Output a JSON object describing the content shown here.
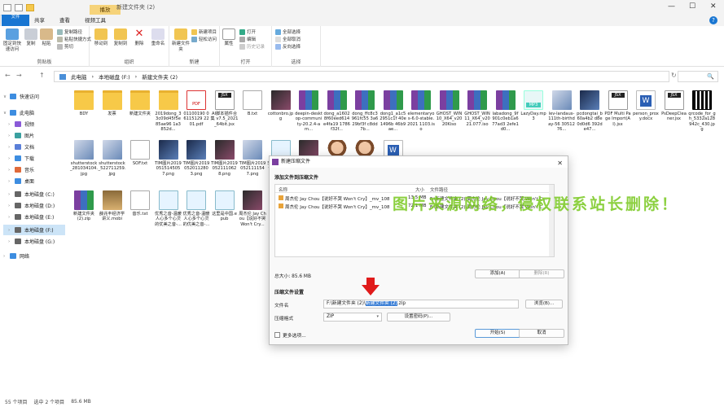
{
  "window": {
    "context_tab": "播放",
    "title": "新建文件夹 (2)",
    "minimize": "—",
    "maximize": "☐",
    "close": "✕"
  },
  "tabs": [
    "文件",
    "主页",
    "共享",
    "查看",
    "视频工具"
  ],
  "ribbon": {
    "clipboard": {
      "label": "剪贴板",
      "pin": "固定到快速访问",
      "copy": "复制",
      "paste": "粘贴",
      "copy_path": "复制路径",
      "paste_shortcut": "粘贴快捷方式",
      "cut": "剪切"
    },
    "organize": {
      "label": "组织",
      "move_to": "移动到",
      "copy_to": "复制到",
      "delete": "删除",
      "rename": "重命名"
    },
    "new": {
      "label": "新建",
      "new_folder": "新建文件夹",
      "new_item": "新建项目",
      "easy_access": "轻松访问"
    },
    "open": {
      "label": "打开",
      "properties": "属性",
      "open": "打开",
      "edit": "编辑",
      "history": "历史记录"
    },
    "select": {
      "label": "选择",
      "select_all": "全部选择",
      "select_none": "全部取消",
      "invert": "反向选择"
    }
  },
  "address": {
    "back": "←",
    "forward": "→",
    "up": "↑",
    "breadcrumb": [
      "此电脑",
      "本地磁盘 (F:)",
      "新建文件夹 (2)"
    ],
    "refresh": "↻",
    "search_icon": "🔍"
  },
  "nav": [
    {
      "label": "快速访问",
      "expanded": true,
      "selected": false
    },
    {
      "label": "此电脑",
      "expanded": true,
      "selected": false
    },
    {
      "label": "视频",
      "expanded": false,
      "selected": false
    },
    {
      "label": "图片",
      "expanded": false,
      "selected": false
    },
    {
      "label": "文档",
      "expanded": false,
      "selected": false
    },
    {
      "label": "下载",
      "expanded": false,
      "selected": false
    },
    {
      "label": "音乐",
      "expanded": false,
      "selected": false
    },
    {
      "label": "桌面",
      "expanded": false,
      "selected": false
    },
    {
      "label": "本地磁盘 (C:)",
      "expanded": false,
      "selected": false
    },
    {
      "label": "本地磁盘 (D:)",
      "expanded": false,
      "selected": false
    },
    {
      "label": "本地磁盘 (E:)",
      "expanded": false,
      "selected": false
    },
    {
      "label": "本地磁盘 (F:)",
      "expanded": false,
      "selected": true
    },
    {
      "label": "本地磁盘 (G:)",
      "expanded": false,
      "selected": false
    },
    {
      "label": "网络",
      "expanded": false,
      "selected": false
    }
  ],
  "files_row1": [
    {
      "name": "BDY",
      "type": "folder"
    },
    {
      "name": "发票",
      "type": "folder"
    },
    {
      "name": "新建文件夹",
      "type": "folder"
    },
    {
      "name": "2019dong_33c09d45f5e85ae96 1a3852d...",
      "type": "folder"
    },
    {
      "name": "01100190 06115129 2201.pdf",
      "type": "pdf"
    },
    {
      "name": "AI脚本插件合集 v7.5_2021_64bit.jsx",
      "type": "jsx"
    },
    {
      "name": "B.txt",
      "type": "txt"
    },
    {
      "name": "cottonbro.jpg",
      "type": "img3"
    },
    {
      "name": "deepin-desktop-community-20.2.4-am...",
      "type": "rar"
    },
    {
      "name": "dong_a16028f60eed614e4fa19 1786f32f...",
      "type": "rar"
    },
    {
      "name": "dong_ffc8c3961fc55 3a629bf3f c8dd7b...",
      "type": "rar"
    },
    {
      "name": "dong1_a1c52951c1f 40e1496b 46b9ae...",
      "type": "rar"
    },
    {
      "name": "elementaryos-6.0-stable.2021 1103.iso",
      "type": "rar"
    },
    {
      "name": "GHOST_WIN10_X64_v2020Kiso",
      "type": "rar"
    },
    {
      "name": "GHOST_WIN11_X64_v2021.077.iso",
      "type": "rar"
    },
    {
      "name": "labadong_9f901c0eb1a677ad3 2efe1d0...",
      "type": "rar"
    },
    {
      "name": "LazyDay.mp3",
      "type": "mp3"
    },
    {
      "name": "lev-landaus-111th-birthday-56 3051276...",
      "type": "img2"
    },
    {
      "name": "pcdongtai_b60a4b2 d8e0d0d6 392de47...",
      "type": "img"
    },
    {
      "name": "PDF Multi Page Import(AI).jsx",
      "type": "jsx"
    },
    {
      "name": "person_proxy.docx",
      "type": "word"
    },
    {
      "name": "PsDeepCleaner.jsx",
      "type": "jsx"
    },
    {
      "name": "qrcode_for_gh_5332a128942c_430.jpg",
      "type": "qr"
    }
  ],
  "files_row2": [
    {
      "name": "shutterstock_281034104.jpg",
      "type": "img2"
    },
    {
      "name": "shutterstock_522711259.jpg",
      "type": "img2"
    },
    {
      "name": "SOF.txt",
      "type": "txt"
    },
    {
      "name": "TIM图片20190515145057.png",
      "type": "img"
    },
    {
      "name": "TIM图片20190520112803.png",
      "type": "img"
    },
    {
      "name": "TIM图片20190521110628.png",
      "type": "img3"
    },
    {
      "name": "TIM图片20190521111547.png",
      "type": "img2"
    },
    {
      "name": "李延涛院子 工作手册.epub",
      "type": "epub"
    },
    {
      "name": "微信图片_20191029164607.jpg",
      "type": "img3"
    },
    {
      "name": "未标题-2-01.jpg",
      "type": "cartoon"
    },
    {
      "name": "未标题-2-02.jpg",
      "type": "cartoon"
    },
    {
      "name": "项目文字准确渠论99.docx",
      "type": "word"
    }
  ],
  "files_row3": [
    {
      "name": "新建文件夹 (2).zip",
      "type": "rar"
    },
    {
      "name": "薛兆丰经济学讲义.mobi",
      "type": "mobi"
    },
    {
      "name": "音乐.txt",
      "type": "txt"
    },
    {
      "name": "优秀之音-温暖人心多个心灵的优美之音-...",
      "type": "epub"
    },
    {
      "name": "优秀之音-温暖人心多个心灵的优美之音-...",
      "type": "epub"
    },
    {
      "name": "这里是中国.epub",
      "type": "epub"
    },
    {
      "name": "周杰伦 Jay Chou【说好不哭 Won't Cry...",
      "type": "img3"
    }
  ],
  "status": {
    "items": "55 个项目",
    "selected": "选中 2 个项目",
    "size": "85.6 MB"
  },
  "dialog": {
    "title": "新建压缩文件",
    "close": "✕",
    "section_add": "添加文件到压缩文件",
    "columns": {
      "name": "名称",
      "size": "大小",
      "path": "文件路径"
    },
    "rows": [
      {
        "name": "周杰伦 Jay Chou【说好不哭 Won't Cry】_mv_1080...",
        "size": "13.5 MB",
        "path": "F:\\新建文件夹 (2)\\周杰伦 Jay Chou【说好不哭 Won't C..."
      },
      {
        "name": "周杰伦 Jay Chou【说好不哭 Won't Cry】_mv_1080...",
        "size": "72.1 MB",
        "path": "F:\\新建文件夹 (2)\\周杰伦 Jay Chou【说好不哭 Won't C..."
      }
    ],
    "total_label": "总大小: 85.6 MB",
    "add_button": "添加(A)",
    "remove_button": "删除(R)",
    "section_settings": "压缩文件设置",
    "filename_label": "文件名",
    "filename_prefix": "F:\\新建文件夹 (2)\\",
    "filename_selected": "新建文件夹 (2)",
    "filename_suffix": ".zip",
    "browse_button": "浏览(B)...",
    "format_label": "压缩格式",
    "format_value": "ZIP",
    "password_button": "设置密码(P)...",
    "more_options": "更多选项...",
    "start_button": "开始(S)",
    "cancel_button": "取消"
  },
  "watermark": "图片来源网络，侵权联系站长删除！"
}
